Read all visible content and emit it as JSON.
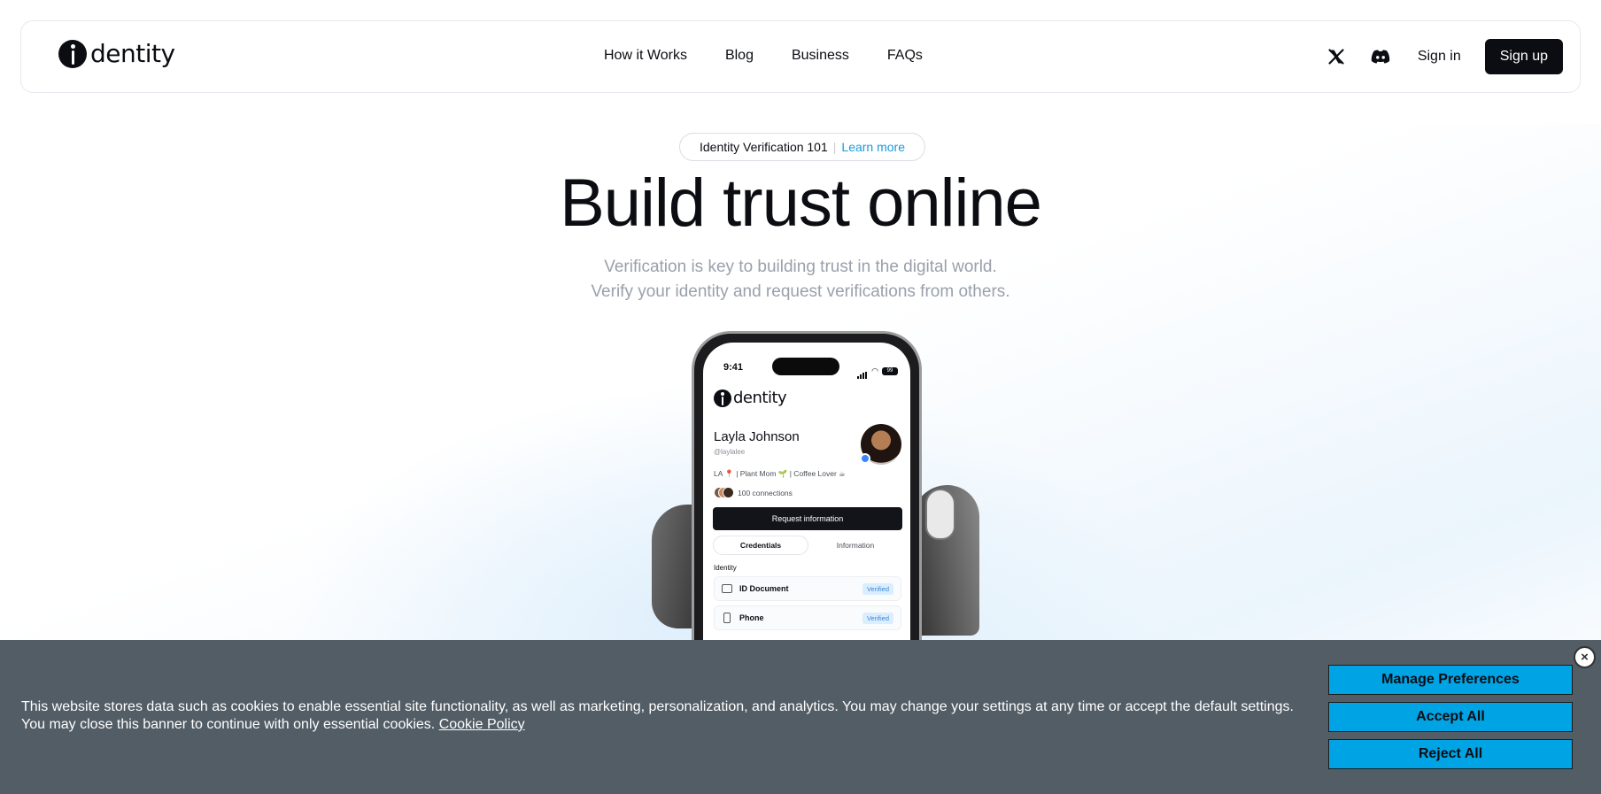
{
  "header": {
    "logo_text": "dentity",
    "nav": [
      "How it Works",
      "Blog",
      "Business",
      "FAQs"
    ],
    "twitter_icon": "x-icon",
    "discord_icon": "discord-icon",
    "signin_label": "Sign in",
    "signup_label": "Sign up"
  },
  "hero": {
    "pill_text": "Identity Verification 101",
    "pill_sep": "|",
    "pill_link": "Learn more",
    "title": "Build trust online",
    "subtitle_line1": "Verification is key to building trust in the digital world.",
    "subtitle_line2": "Verify your identity and request verifications from others."
  },
  "phone": {
    "time": "9:41",
    "battery": "99",
    "logo_text": "dentity",
    "name": "Layla Johnson",
    "handle": "@laylalee",
    "bio": "LA 📍 | Plant Mom 🌱 | Coffee Lover ☕",
    "connections": "100 connections",
    "request_button": "Request information",
    "tabs": [
      "Credentials",
      "Information"
    ],
    "section": "Identity",
    "rows": [
      {
        "label": "ID Document",
        "status": "Verified"
      },
      {
        "label": "Phone",
        "status": "Verified"
      }
    ]
  },
  "cookie": {
    "text": "This website stores data such as cookies to enable essential site functionality, as well as marketing, personalization, and analytics. You may change your settings at any time or accept the default settings. You may close this banner to continue with only essential cookies.",
    "policy_link": "Cookie Policy",
    "close_label": "×",
    "manage_label": "Manage Preferences",
    "accept_label": "Accept All",
    "reject_label": "Reject All"
  },
  "colors": {
    "accent": "#1a9bd7",
    "cookie_bg": "#525d66",
    "cookie_button": "#00a3e4",
    "dark": "#0b0d12"
  }
}
